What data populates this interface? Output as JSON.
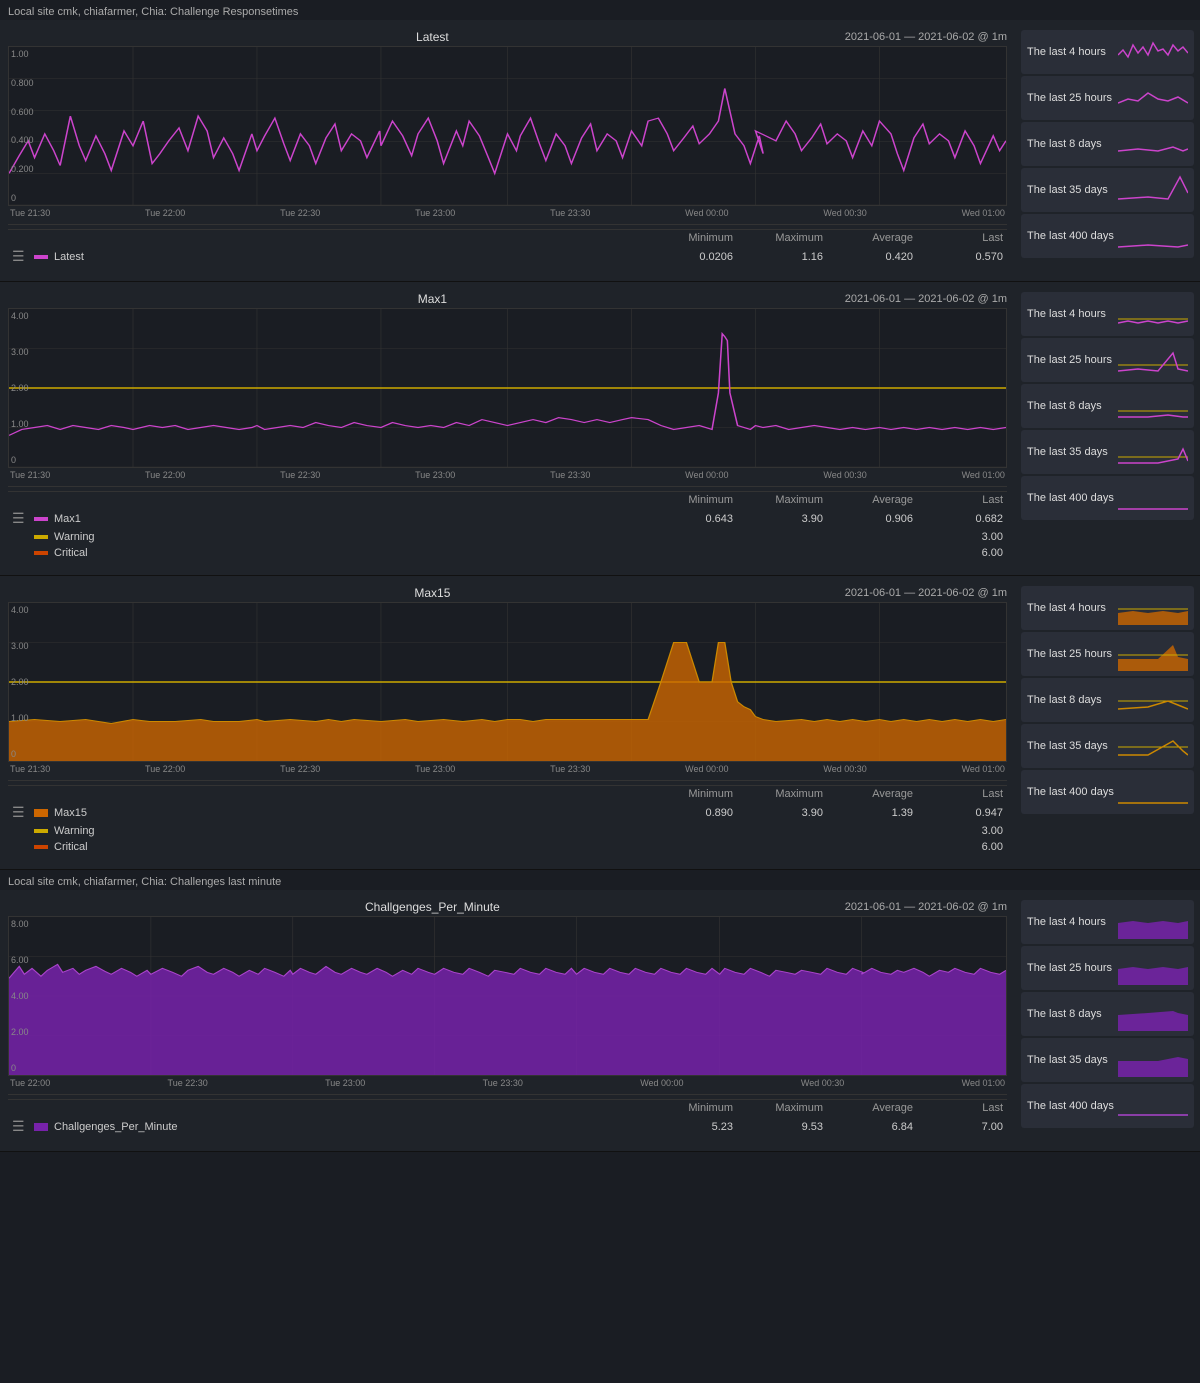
{
  "app": {
    "title": "Local site cmk, chiafarmer, Chia: Challenge Responsetimes",
    "title2": "Local site cmk, chiafarmer, Chia: Challenges last minute"
  },
  "panels": [
    {
      "id": "latest",
      "title": "Latest",
      "date": "2021-06-01 — 2021-06-02 @ 1m",
      "yLabels": [
        "1.00",
        "0.800",
        "0.600",
        "0.400",
        "0.200",
        "0"
      ],
      "xLabels": [
        "Tue 21:30",
        "Tue 22:00",
        "Tue 22:30",
        "Tue 23:00",
        "Tue 23:30",
        "Wed 00:00",
        "Wed 00:30",
        "Wed 01:00"
      ],
      "series": [
        {
          "name": "Latest",
          "color": "#cc44cc",
          "type": "line",
          "min": "0.0206",
          "max": "1.16",
          "avg": "0.420",
          "last": "0.570"
        }
      ],
      "thresholds": []
    },
    {
      "id": "max1",
      "title": "Max1",
      "date": "2021-06-01 — 2021-06-02 @ 1m",
      "yLabels": [
        "4.00",
        "3.00",
        "2.00",
        "1.00",
        "0"
      ],
      "xLabels": [
        "Tue 21:30",
        "Tue 22:00",
        "Tue 22:30",
        "Tue 23:00",
        "Tue 23:30",
        "Wed 00:00",
        "Wed 00:30",
        "Wed 01:00"
      ],
      "series": [
        {
          "name": "Max1",
          "color": "#cc44cc",
          "type": "line",
          "min": "0.643",
          "max": "3.90",
          "avg": "0.906",
          "last": "0.682"
        },
        {
          "name": "Warning",
          "color": "#ccaa00",
          "type": "threshold",
          "min": "",
          "max": "",
          "avg": "",
          "last": "3.00"
        },
        {
          "name": "Critical",
          "color": "#cc4400",
          "type": "threshold",
          "min": "",
          "max": "",
          "avg": "",
          "last": "6.00"
        }
      ],
      "thresholds": [
        {
          "value": 3.0,
          "color": "#ccaa00"
        },
        {
          "value": 6.0,
          "color": "#cc4400"
        }
      ]
    },
    {
      "id": "max15",
      "title": "Max15",
      "date": "2021-06-01 — 2021-06-02 @ 1m",
      "yLabels": [
        "4.00",
        "3.00",
        "2.00",
        "1.00",
        "0"
      ],
      "xLabels": [
        "Tue 21:30",
        "Tue 22:00",
        "Tue 22:30",
        "Tue 23:00",
        "Tue 23:30",
        "Wed 00:00",
        "Wed 00:30",
        "Wed 01:00"
      ],
      "series": [
        {
          "name": "Max15",
          "color": "#cc6600",
          "type": "area",
          "min": "0.890",
          "max": "3.90",
          "avg": "1.39",
          "last": "0.947"
        },
        {
          "name": "Warning",
          "color": "#ccaa00",
          "type": "threshold",
          "min": "",
          "max": "",
          "avg": "",
          "last": "3.00"
        },
        {
          "name": "Critical",
          "color": "#cc4400",
          "type": "threshold",
          "min": "",
          "max": "",
          "avg": "",
          "last": "6.00"
        }
      ],
      "thresholds": [
        {
          "value": 3.0,
          "color": "#ccaa00"
        },
        {
          "value": 6.0,
          "color": "#cc4400"
        }
      ]
    }
  ],
  "panel4": {
    "id": "challgenges_per_minute",
    "title": "Challgenges_Per_Minute",
    "date": "2021-06-01 — 2021-06-02 @ 1m",
    "yLabels": [
      "8.00",
      "6.00",
      "4.00",
      "2.00",
      "0"
    ],
    "xLabels": [
      "Tue 22:00",
      "Tue 22:30",
      "Tue 23:00",
      "Tue 23:30",
      "Wed 00:00",
      "Wed 00:30",
      "Wed 01:00"
    ],
    "series": [
      {
        "name": "Challgenges_Per_Minute",
        "color": "#9933cc",
        "type": "area",
        "min": "5.23",
        "max": "9.53",
        "avg": "6.84",
        "last": "7.00"
      }
    ]
  },
  "sidebar": {
    "timeRanges": [
      "The last 4 hours",
      "The last 25 hours",
      "The last 8 days",
      "The last 35 days",
      "The last 400 days"
    ]
  },
  "stats_header": {
    "minimum": "Minimum",
    "maximum": "Maximum",
    "average": "Average",
    "last": "Last"
  }
}
